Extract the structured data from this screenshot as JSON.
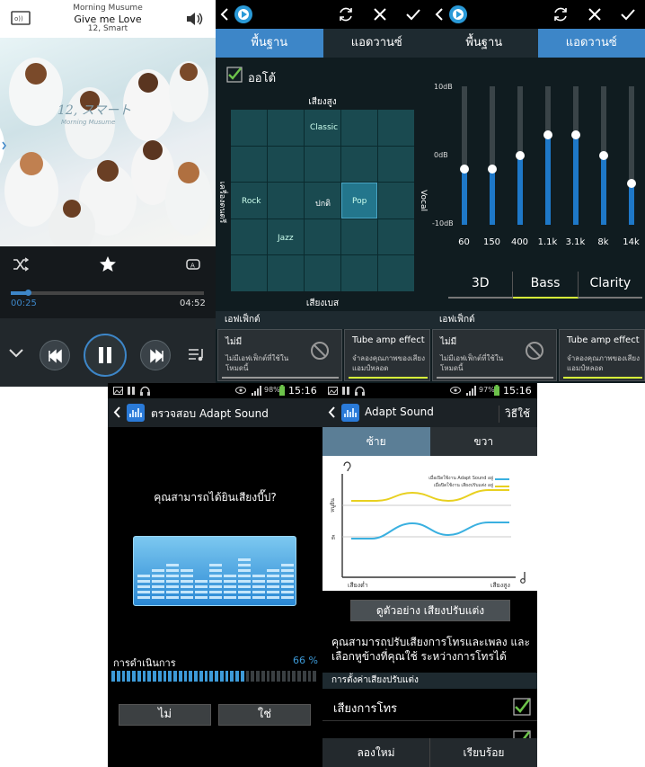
{
  "player": {
    "artist": "Morning Musume",
    "title": "Give me Love",
    "album": "12, Smart",
    "album_art_title": "12, スマート",
    "album_art_sub": "Morning Musume",
    "elapsed": "00:25",
    "total": "04:52",
    "progress": 0.09
  },
  "eq_basic": {
    "tab_basic": "พื้นฐาน",
    "tab_advanced": "แอดวานซ์",
    "auto_label": "ออโต้",
    "top_label": "เสียงสูง",
    "bottom_label": "เสียงเบส",
    "left_label": "เครื่องดนตรี",
    "right_label": "Vocal",
    "cells": {
      "classic": "Classic",
      "rock": "Rock",
      "normal": "ปกติ",
      "pop": "Pop",
      "jazz": "Jazz"
    },
    "effects_header": "เอฟเฟ็กต์",
    "none_title": "ไม่มี",
    "none_desc": "ไม่มีเอฟเฟ็กต์ที่ใช้ในโหมดนี้",
    "tube_title": "Tube amp effect",
    "tube_desc": "จำลองคุณภาพของเสียงแอมป์หลอด"
  },
  "eq_advanced": {
    "tab_basic": "พื้นฐาน",
    "tab_advanced": "แอดวานซ์",
    "db_top": "10dB",
    "db_mid": "0dB",
    "db_bot": "-10dB",
    "bands": [
      "60",
      "150",
      "400",
      "1.1k",
      "3.1k",
      "8k",
      "14k"
    ],
    "band_levels": [
      -2,
      -2,
      0,
      3,
      3,
      0,
      -4
    ],
    "effect_tabs": [
      "3D",
      "Bass",
      "Clarity"
    ],
    "effects_header": "เอฟเฟ็กต์",
    "none_title": "ไม่มี",
    "none_desc": "ไม่มีเอฟเฟ็กต์ที่ใช้ในโหมดนี้",
    "tube_title": "Tube amp effect",
    "tube_desc": "จำลองคุณภาพของเสียงแอมป์หลอด"
  },
  "adapt_check": {
    "battery": "98%",
    "time": "15:16",
    "title": "ตรวจสอบ Adapt Sound",
    "question": "คุณสามารถได้ยินเสียงบี๊ป?",
    "progress_label": "การดำเนินการ",
    "progress_value": "66 %",
    "progress": 0.66,
    "no_button": "ไม่",
    "yes_button": "ใช่"
  },
  "adapt_sound": {
    "battery": "97%",
    "time": "15:16",
    "title": "Adapt Sound",
    "howto": "วิธีใช้",
    "tab_left": "ซ้าย",
    "tab_right": "ขวา",
    "legend_on": "เมื่อเปิดใช้งาน Adapt Sound อยู่",
    "legend_off": "เมื่อปิดใช้งาน เสียงปรับแต่ง อยู่",
    "y_label": "หนูยิน",
    "y_mid": "ดี",
    "x_low": "เสียงต่ำ",
    "x_high": "เสียงสูง",
    "preview_button": "ดูตัวอย่าง เสียงปรับแต่ง",
    "description": "คุณสามารถปรับเสียงการโทรและเพลง และเลือกหูข้างที่คุณใช้ ระหว่างการโทรได้",
    "settings_header": "การตั้งค่าเสียงปรับแต่ง",
    "call_sound": "เสียงการโทร",
    "reset_button": "ลองใหม่",
    "done_button": "เรียบร้อย"
  },
  "colors": {
    "accent": "#3d86c8",
    "highlight": "#d8ff3a",
    "check": "#6cc24a"
  }
}
